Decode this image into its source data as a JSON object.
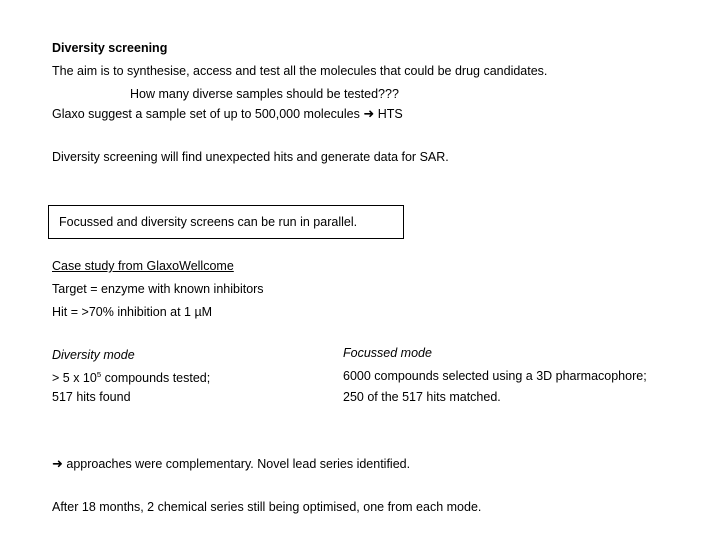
{
  "slide": {
    "title": "Diversity screening",
    "intro_lines": [
      "The aim is to synthesise, access and test all the molecules that could be drug candidates.",
      "How many diverse samples should be tested???"
    ],
    "glaxo_line": {
      "before_arrow": "Glaxo suggest a sample set of up to 500,000 molecules ",
      "arrow_glyph": "➜",
      "after_arrow": " HTS"
    },
    "sar_line": "Diversity screening will find unexpected hits and generate data for SAR.",
    "callout": "Focussed and diversity screens can be run in parallel.",
    "case_study": {
      "heading": "Case study from GlaxoWellcome",
      "target_line": "Target = enzyme with known inhibitors",
      "hit_line": "Hit = >70% inhibition at 1 µM"
    },
    "columns": {
      "left": {
        "heading": "Diversity mode",
        "line1_prefix": "> 5 x 10",
        "line1_exponent": "5",
        "line1_suffix": " compounds tested;",
        "line2": "517 hits found"
      },
      "right": {
        "heading": "Focussed mode",
        "line1": "6000 compounds selected using a 3D pharmacophore;",
        "line2": "250 of the 517 hits matched."
      }
    },
    "conclusion": {
      "arrow_glyph": "➜",
      "text": " approaches were complementary. Novel lead series identified.",
      "followup": "After 18 months, 2 chemical series still being optimised, one from each mode."
    }
  }
}
